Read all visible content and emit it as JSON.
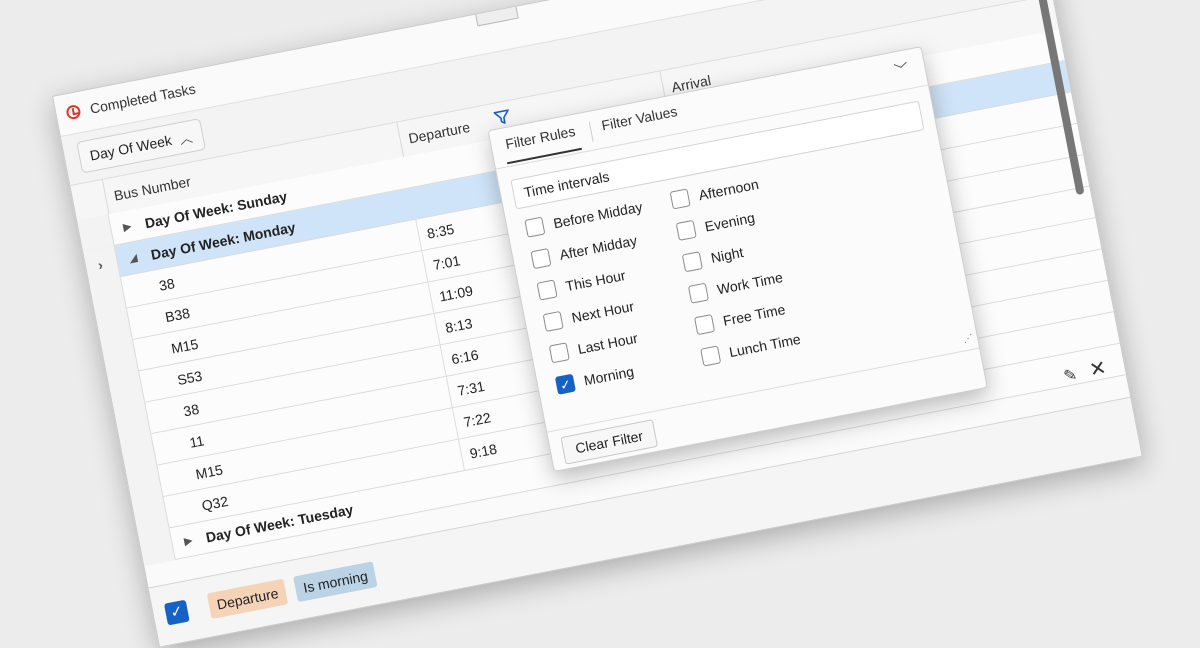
{
  "window": {
    "title": "Completed Tasks"
  },
  "group_panel": {
    "chip_label": "Day Of Week"
  },
  "columns": {
    "bus_number": "Bus Number",
    "departure": "Departure",
    "arrival": "Arrival"
  },
  "groups": {
    "sunday": "Day Of Week: Sunday",
    "monday": "Day Of Week: Monday",
    "tuesday": "Day Of Week: Tuesday"
  },
  "rows": [
    {
      "bus": "38",
      "departure": "8:35"
    },
    {
      "bus": "B38",
      "departure": "7:01"
    },
    {
      "bus": "M15",
      "departure": "11:09"
    },
    {
      "bus": "S53",
      "departure": "8:13"
    },
    {
      "bus": "38",
      "departure": "6:16"
    },
    {
      "bus": "11",
      "departure": "7:31"
    },
    {
      "bus": "M15",
      "departure": "7:22"
    },
    {
      "bus": "Q32",
      "departure": "9:18"
    }
  ],
  "filter_popup": {
    "tabs": {
      "rules": "Filter Rules",
      "values": "Filter Values"
    },
    "intervals_label": "Time intervals",
    "options_left": [
      {
        "label": "Before Midday",
        "checked": false
      },
      {
        "label": "After Midday",
        "checked": false
      },
      {
        "label": "This Hour",
        "checked": false
      },
      {
        "label": "Next Hour",
        "checked": false
      },
      {
        "label": "Last Hour",
        "checked": false
      },
      {
        "label": "Morning",
        "checked": true
      }
    ],
    "options_right": [
      {
        "label": "Afternoon",
        "checked": false
      },
      {
        "label": "Evening",
        "checked": false
      },
      {
        "label": "Night",
        "checked": false
      },
      {
        "label": "Work Time",
        "checked": false
      },
      {
        "label": "Free Time",
        "checked": false
      },
      {
        "label": "Lunch Time",
        "checked": false
      }
    ],
    "clear_button": "Clear Filter"
  },
  "filter_panel": {
    "field_token": "Departure",
    "value_token": "Is morning",
    "enabled": true
  },
  "colors": {
    "accent": "#1661c4",
    "selection": "#cfe4f8",
    "field_token": "#f5d3b6",
    "value_token": "#bcd3e6"
  },
  "icons": [
    "clock-icon",
    "chevron-up-icon",
    "funnel-icon",
    "expand-arrow-icon",
    "row-indicator-icon",
    "chevron-down-icon",
    "check-icon",
    "edit-icon",
    "close-icon",
    "resize-grip-icon"
  ]
}
